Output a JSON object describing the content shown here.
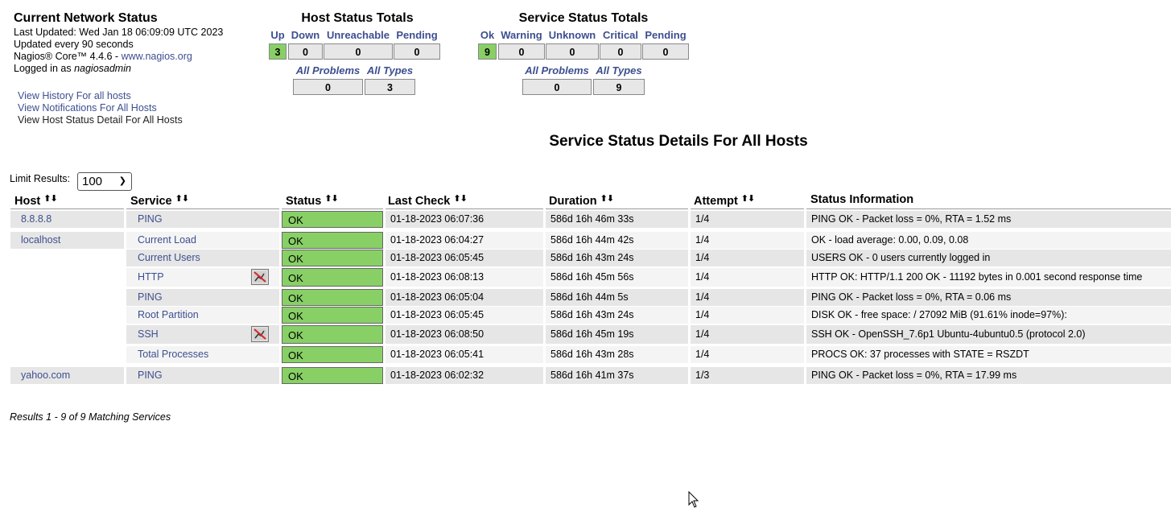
{
  "info": {
    "title": "Current Network Status",
    "last_updated": "Last Updated: Wed Jan 18 06:09:09 UTC 2023",
    "update_interval": "Updated every 90 seconds",
    "version_prefix": "Nagios® Core™ 4.4.6 - ",
    "version_link": "www.nagios.org",
    "logged_in_prefix": "Logged in as ",
    "user": "nagiosadmin"
  },
  "nav_links": [
    "View History For all hosts",
    "View Notifications For All Hosts",
    "View Host Status Detail For All Hosts"
  ],
  "host_totals": {
    "title": "Host Status Totals",
    "headers": [
      "Up",
      "Down",
      "Unreachable",
      "Pending"
    ],
    "values": [
      "3",
      "0",
      "0",
      "0"
    ],
    "sub_headers": [
      "All Problems",
      "All Types"
    ],
    "sub_values": [
      "0",
      "3"
    ]
  },
  "service_totals": {
    "title": "Service Status Totals",
    "headers": [
      "Ok",
      "Warning",
      "Unknown",
      "Critical",
      "Pending"
    ],
    "values": [
      "9",
      "0",
      "0",
      "0",
      "0"
    ],
    "sub_headers": [
      "All Problems",
      "All Types"
    ],
    "sub_values": [
      "0",
      "9"
    ]
  },
  "page_title": "Service Status Details For All Hosts",
  "limit": {
    "label": "Limit Results:",
    "value": "100"
  },
  "columns": [
    "Host",
    "Service",
    "Status",
    "Last Check",
    "Duration",
    "Attempt",
    "Status Information"
  ],
  "rows": [
    {
      "host": "8.8.8.8",
      "service": "PING",
      "status": "OK",
      "last_check": "01-18-2023 06:07:36",
      "duration": "586d 16h 46m 33s",
      "attempt": "1/4",
      "info": "PING OK - Packet loss = 0%, RTA = 1.52 ms"
    },
    {
      "host": "localhost",
      "service": "Current Load",
      "status": "OK",
      "last_check": "01-18-2023 06:04:27",
      "duration": "586d 16h 44m 42s",
      "attempt": "1/4",
      "info": "OK - load average: 0.00, 0.09, 0.08"
    },
    {
      "host": "",
      "service": "Current Users",
      "status": "OK",
      "last_check": "01-18-2023 06:05:45",
      "duration": "586d 16h 43m 24s",
      "attempt": "1/4",
      "info": "USERS OK - 0 users currently logged in"
    },
    {
      "host": "",
      "service": "HTTP",
      "status": "OK",
      "last_check": "01-18-2023 06:08:13",
      "duration": "586d 16h 45m 56s",
      "attempt": "1/4",
      "info": "HTTP OK: HTTP/1.1 200 OK - 11192 bytes in 0.001 second response time"
    },
    {
      "host": "",
      "service": "PING",
      "status": "OK",
      "last_check": "01-18-2023 06:05:04",
      "duration": "586d 16h 44m 5s",
      "attempt": "1/4",
      "info": "PING OK - Packet loss = 0%, RTA = 0.06 ms"
    },
    {
      "host": "",
      "service": "Root Partition",
      "status": "OK",
      "last_check": "01-18-2023 06:05:45",
      "duration": "586d 16h 43m 24s",
      "attempt": "1/4",
      "info": "DISK OK - free space: / 27092 MiB (91.61% inode=97%):"
    },
    {
      "host": "",
      "service": "SSH",
      "status": "OK",
      "last_check": "01-18-2023 06:08:50",
      "duration": "586d 16h 45m 19s",
      "attempt": "1/4",
      "info": "SSH OK - OpenSSH_7.6p1 Ubuntu-4ubuntu0.5 (protocol 2.0)"
    },
    {
      "host": "",
      "service": "Total Processes",
      "status": "OK",
      "last_check": "01-18-2023 06:05:41",
      "duration": "586d 16h 43m 28s",
      "attempt": "1/4",
      "info": "PROCS OK: 37 processes with STATE = RSZDT"
    },
    {
      "host": "yahoo.com",
      "service": "PING",
      "status": "OK",
      "last_check": "01-18-2023 06:02:32",
      "duration": "586d 16h 41m 37s",
      "attempt": "1/3",
      "info": "PING OK - Packet loss = 0%, RTA = 17.99 ms"
    }
  ],
  "results_text": "Results 1 - 9 of 9 Matching Services",
  "colors": {
    "ok_green": "#88d066",
    "link_blue": "#3d4f8f",
    "row_gray": "#e6e6e6"
  }
}
